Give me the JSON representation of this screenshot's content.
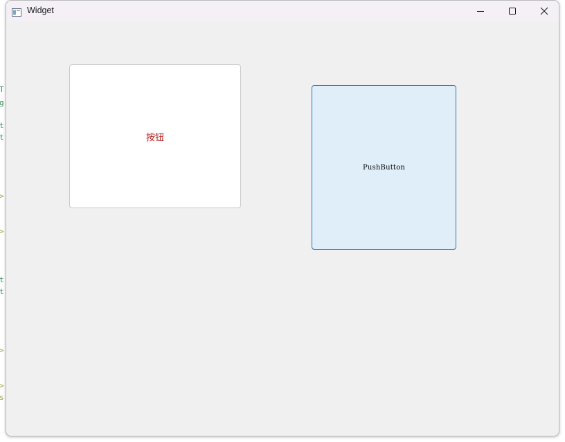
{
  "window": {
    "title": "Widget",
    "controls": {
      "minimize_icon": "minimize-icon",
      "maximize_icon": "maximize-icon",
      "close_icon": "close-icon"
    }
  },
  "buttons": {
    "button_cn": {
      "label": "按钮",
      "text_color": "#b31b1b",
      "background": "#ffffff"
    },
    "push_button": {
      "label": "PushButton",
      "background": "#e0eef9",
      "border_color": "#1f77b4"
    }
  },
  "background_fragments": [
    {
      "text": "T",
      "color": "#2e8b57"
    },
    {
      "text": "g",
      "color": "#2e8b57"
    },
    {
      "text": "t",
      "color": "#2e8b57"
    },
    {
      "text": "t",
      "color": "#2e8b57"
    },
    {
      "text": ">",
      "color": "#a0a040"
    },
    {
      "text": ">",
      "color": "#a0a040"
    },
    {
      "text": "t",
      "color": "#2e8b57"
    },
    {
      "text": "t",
      "color": "#2e8b57"
    },
    {
      "text": ">",
      "color": "#a0a040"
    },
    {
      "text": ">",
      "color": "#a0a040"
    },
    {
      "text": "s",
      "color": "#a0a040"
    }
  ]
}
